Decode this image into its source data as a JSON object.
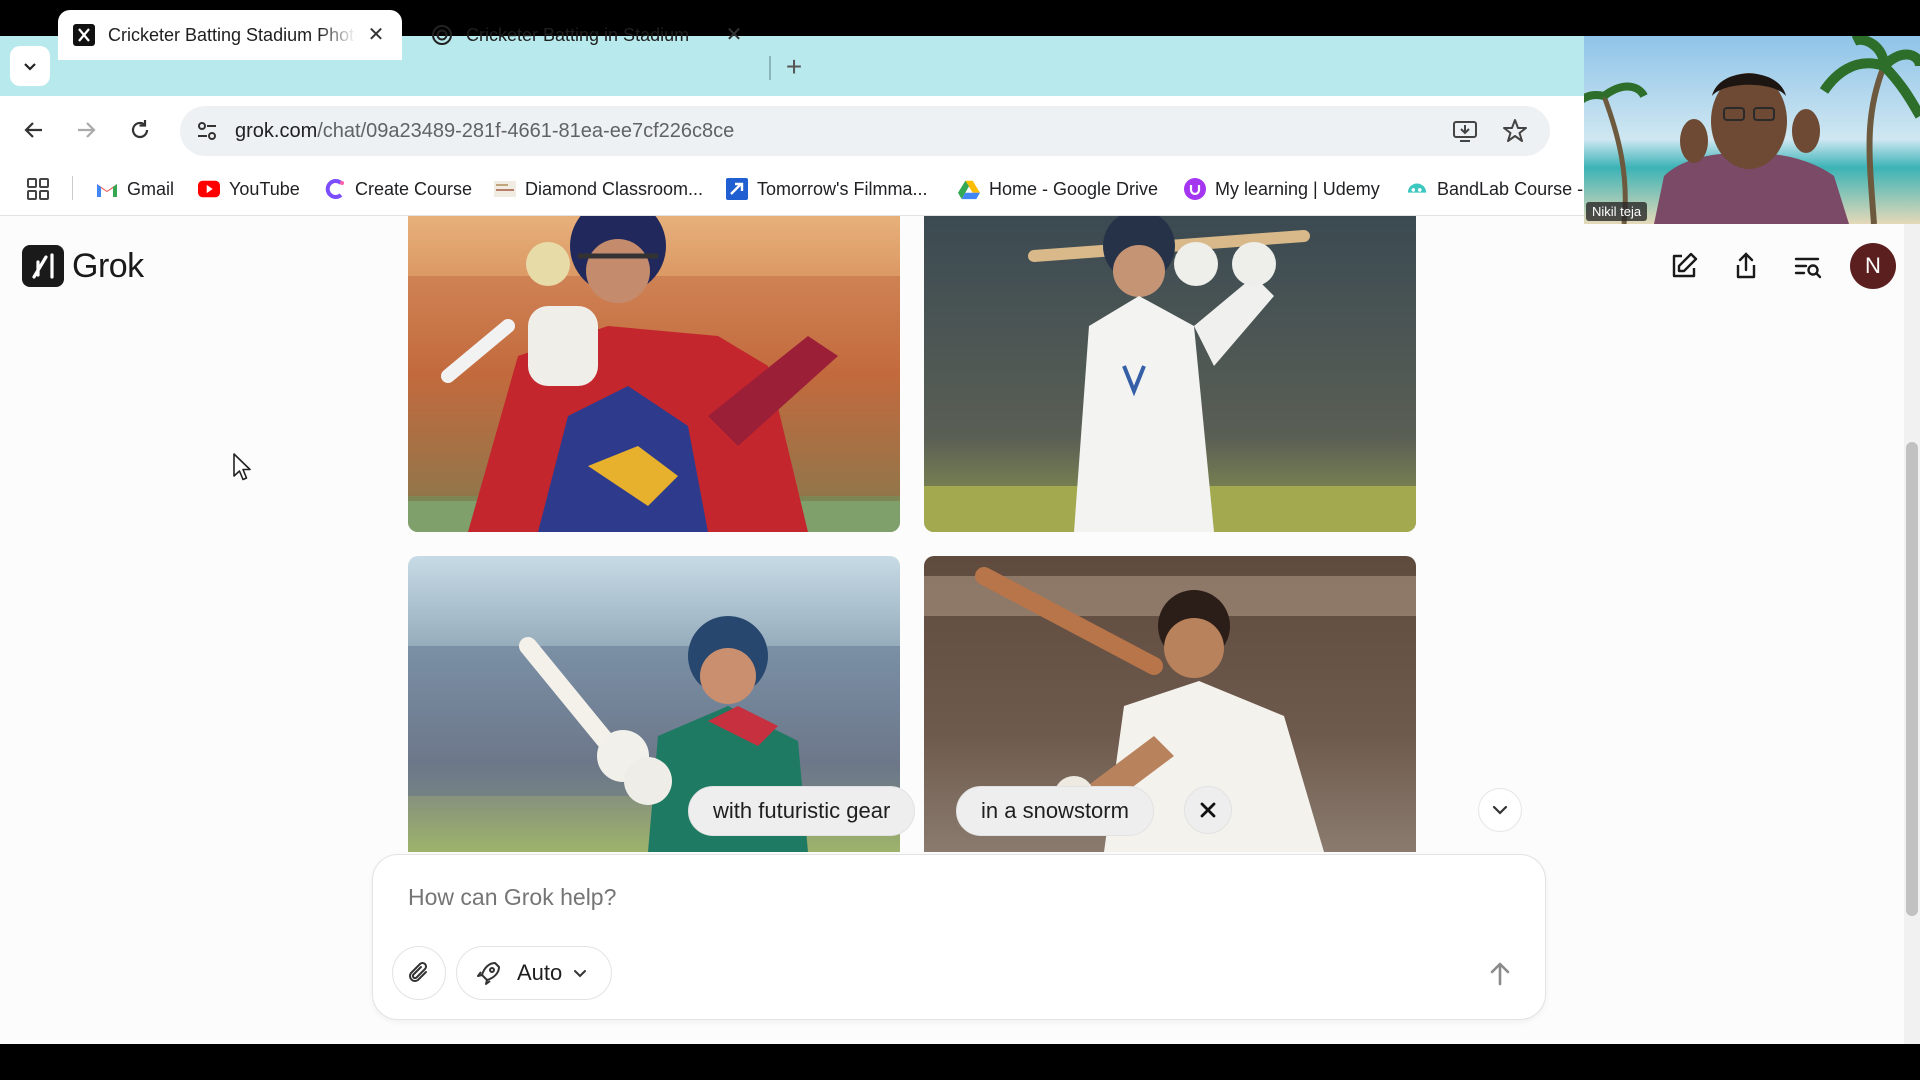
{
  "browser": {
    "tabs": [
      {
        "title": "Cricketer Batting Stadium Photo",
        "favicon": "x-grok-icon",
        "active": true
      },
      {
        "title": "Cricketer Batting in Stadium",
        "favicon": "openai-icon",
        "active": false
      }
    ],
    "new_tab_label": "+",
    "url_host": "grok.com",
    "url_path": "/chat/09a23489-281f-4661-81ea-ee7cf226c8ce",
    "bookmarks": [
      {
        "label": "Gmail",
        "icon": "gmail-icon"
      },
      {
        "label": "YouTube",
        "icon": "youtube-icon"
      },
      {
        "label": "Create Course",
        "icon": "create-course-icon"
      },
      {
        "label": "Diamond Classroom...",
        "icon": "diamond-classroom-icon"
      },
      {
        "label": "Tomorrow's Filmma...",
        "icon": "filmmaker-icon"
      },
      {
        "label": "Home - Google Drive",
        "icon": "google-drive-icon"
      },
      {
        "label": "My learning | Udemy",
        "icon": "udemy-icon"
      },
      {
        "label": "BandLab Course -",
        "icon": "bandlab-icon"
      }
    ]
  },
  "app": {
    "name": "Grok",
    "avatar_initial": "N"
  },
  "suggestions": [
    "with futuristic gear",
    "in a snowstorm"
  ],
  "composer": {
    "placeholder": "How can Grok help?",
    "model_label": "Auto"
  },
  "webcam": {
    "name": "Nikil teja"
  },
  "colors": {
    "tabstrip": "#b8e9ec",
    "page_bg": "#fcfcfc",
    "avatar_bg": "#5b1f1f"
  }
}
